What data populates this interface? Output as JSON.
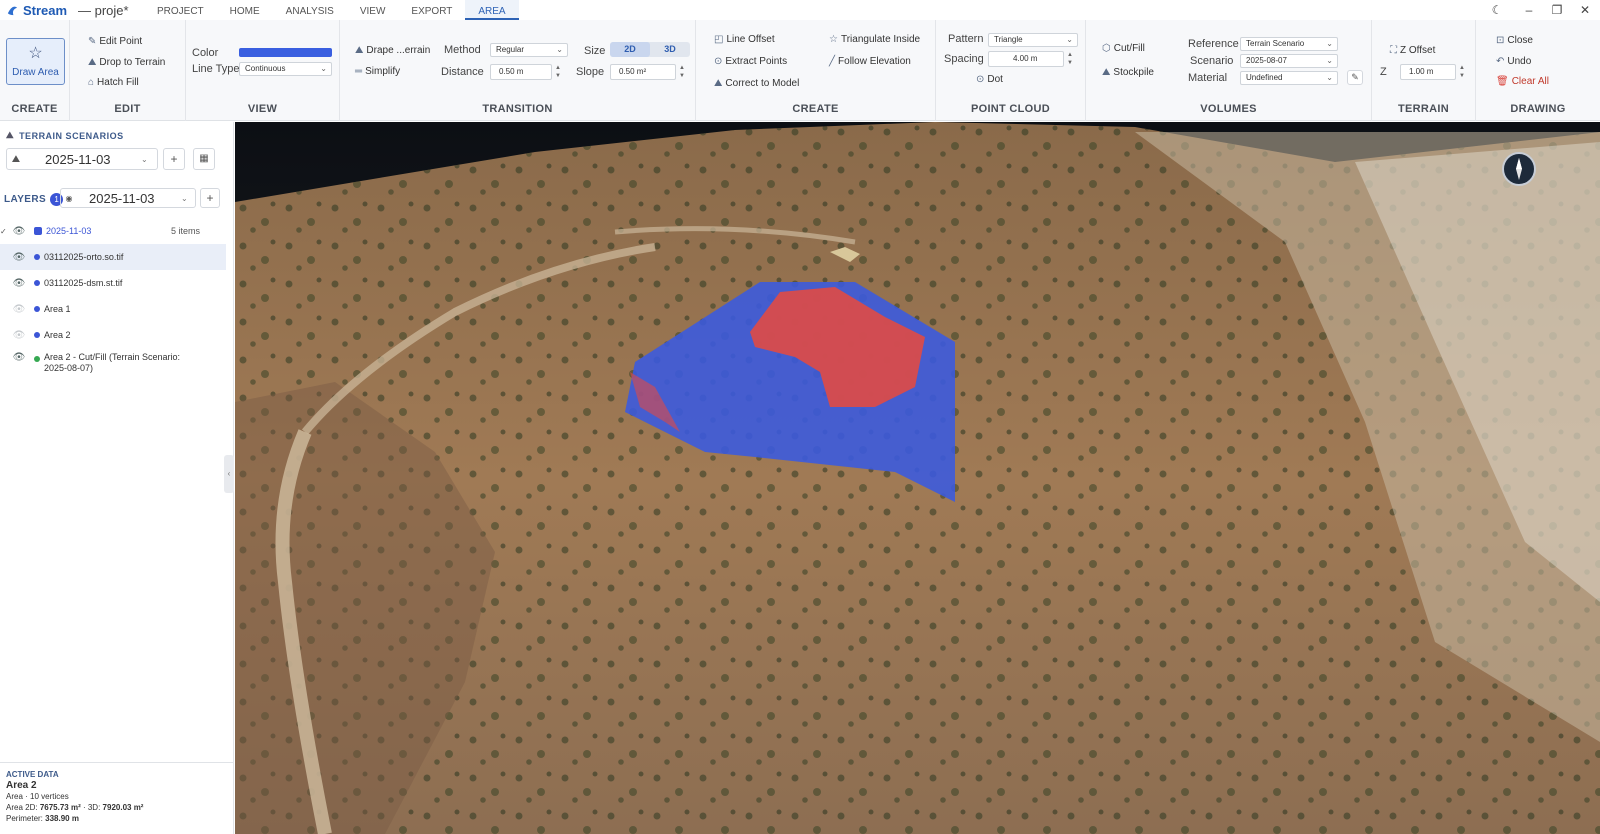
{
  "app": {
    "name": "Stream",
    "doc_title": "— proje*",
    "menu_tabs": [
      "PROJECT",
      "HOME",
      "ANALYSIS",
      "VIEW",
      "EXPORT",
      "AREA"
    ],
    "active_tab": "AREA"
  },
  "ribbon": {
    "create": {
      "title": "CREATE",
      "draw_area": "Draw Area"
    },
    "edit": {
      "title": "EDIT",
      "edit_point": "Edit Point",
      "drop_to_terrain": "Drop to Terrain",
      "hatch_fill": "Hatch Fill"
    },
    "view": {
      "title": "VIEW",
      "color_label": "Color",
      "color_value": "#3a5fe0",
      "line_type_label": "Line Type",
      "line_type_value": "Continuous"
    },
    "transition": {
      "title": "TRANSITION",
      "drape_terrain": "Drape ...errain",
      "simplify": "Simplify",
      "method_label": "Method",
      "method_value": "Regular",
      "distance_label": "Distance",
      "distance_value": "0.50 m",
      "size_label": "Size",
      "size_2d": "2D",
      "size_3d": "3D",
      "slope_label": "Slope",
      "slope_value": "0.50 m²"
    },
    "create2": {
      "title": "CREATE",
      "line_offset": "Line Offset",
      "extract_points": "Extract Points",
      "correct_to_model": "Correct to Model",
      "triangulate_inside": "Triangulate Inside",
      "follow_elevation": "Follow Elevation"
    },
    "point_cloud": {
      "title": "POINT CLOUD",
      "pattern_label": "Pattern",
      "pattern_value": "Triangle",
      "spacing_label": "Spacing",
      "spacing_value": "4.00 m",
      "dot": "Dot"
    },
    "volumes": {
      "title": "VOLUMES",
      "cut_fill": "Cut/Fill",
      "stockpile": "Stockpile",
      "reference_label": "Reference",
      "reference_value": "Terrain Scenario",
      "scenario_label": "Scenario",
      "scenario_value": "2025-08-07",
      "material_label": "Material",
      "material_value": "Undefined"
    },
    "terrain": {
      "title": "TERRAIN",
      "z_offset": "Z Offset",
      "z_label": "Z",
      "z_value": "1.00 m"
    },
    "drawing": {
      "title": "DRAWING",
      "close": "Close",
      "undo": "Undo",
      "clear_all": "Clear All"
    }
  },
  "left_panel": {
    "terrain_scenarios_title": "TERRAIN SCENARIOS",
    "scenario_value": "2025-11-03",
    "layers_title": "LAYERS",
    "layers_badge": "1",
    "layer_value": "2025-11-03",
    "tree": [
      {
        "label": "2025-11-03",
        "meta": "5 items",
        "visible": true,
        "color": "#3b55d6",
        "group": true
      },
      {
        "label": "03112025-orto.so.tif",
        "visible": true,
        "color": "#3b55d6",
        "selected": true
      },
      {
        "label": "03112025-dsm.st.tif",
        "visible": true,
        "color": "#3b55d6"
      },
      {
        "label": "Area 1",
        "visible": false,
        "color": "#3b55d6"
      },
      {
        "label": "Area 2",
        "visible": false,
        "color": "#3b55d6"
      },
      {
        "label": "Area 2 - Cut/Fill (Terrain Scenario: 2025-08-07)",
        "visible": true,
        "color": "#36a852"
      }
    ],
    "active_data": {
      "header": "ACTIVE DATA",
      "name": "Area 2",
      "sub": "Area · 10 vertices",
      "area_label": "Area 2D:",
      "area_2d": "7675.73 m²",
      "area_3d_label": "· 3D:",
      "area_3d": "7920.03 m²",
      "perimeter_label": "Perimeter:",
      "perimeter": "338.90 m"
    }
  },
  "viewport": {
    "overlay_colors": {
      "fill": "#3a5ae0",
      "cut": "#e04a44"
    }
  }
}
